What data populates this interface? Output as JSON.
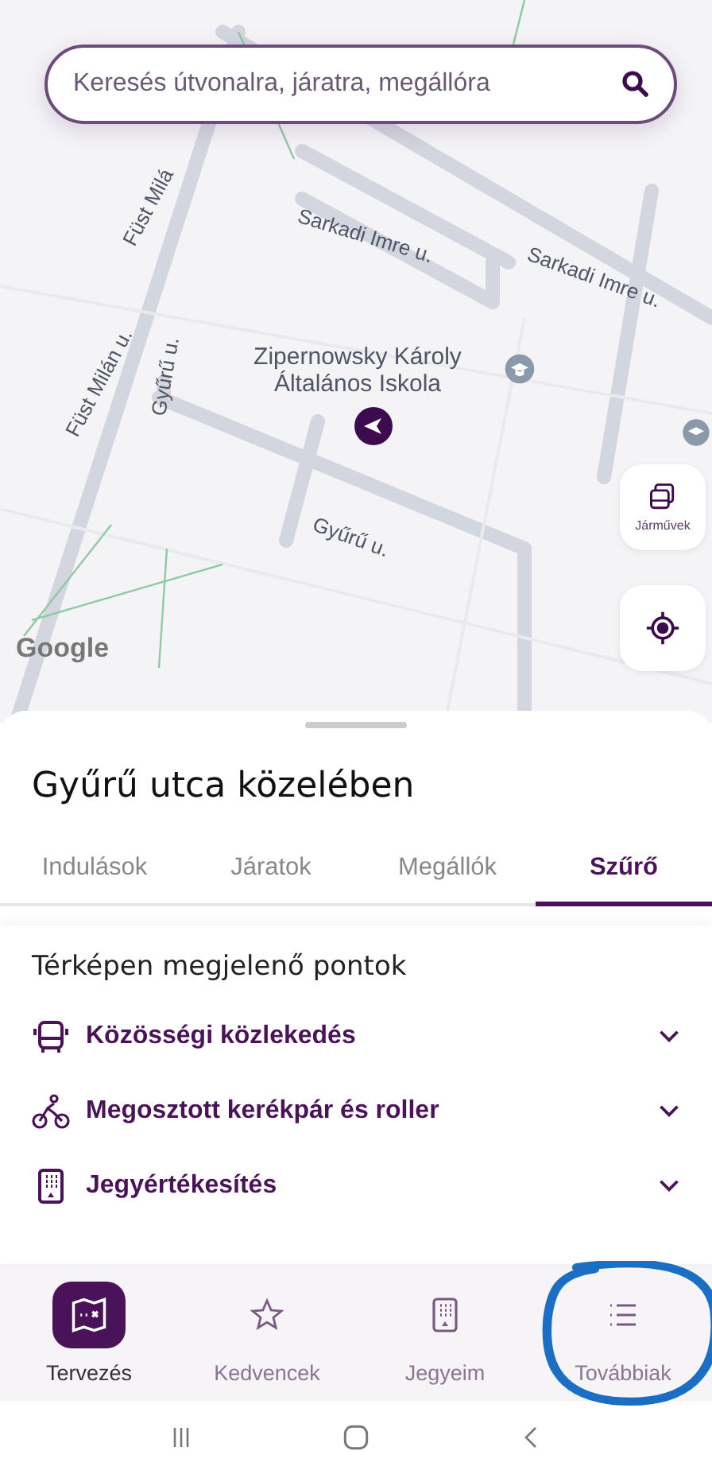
{
  "map": {
    "labels": [
      {
        "text": "Füst Milá",
        "kind": "street"
      },
      {
        "text": "Sarkadi Imre u.",
        "kind": "street"
      },
      {
        "text": "Sarkadi Imre u.",
        "kind": "street"
      },
      {
        "text": "Füst Milán u.",
        "kind": "street"
      },
      {
        "text": "Gyűrű u.",
        "kind": "street"
      },
      {
        "text": "Gyűrű u.",
        "kind": "street"
      },
      {
        "text": "Zipernowsky Károly Általános Iskola",
        "kind": "poi"
      },
      {
        "text": "Google",
        "kind": "logo"
      }
    ],
    "vehicles_button": {
      "label": "Járművek"
    }
  },
  "search": {
    "placeholder": "Keresés útvonalra, járatra, megállóra"
  },
  "sheet": {
    "title": "Gyűrű utca közelében",
    "tabs": [
      {
        "label": "Indulások",
        "selected": false
      },
      {
        "label": "Járatok",
        "selected": false
      },
      {
        "label": "Megállók",
        "selected": false
      },
      {
        "label": "Szűrő",
        "selected": true
      }
    ],
    "section_title": "Térképen megjelenő pontok",
    "filters": [
      {
        "kind": "bus",
        "label": "Közösségi közlekedés",
        "expanded": false
      },
      {
        "kind": "bike",
        "label": "Megosztott kerékpár és roller",
        "expanded": false
      },
      {
        "kind": "ticket",
        "label": "Jegyértékesítés",
        "expanded": false
      }
    ]
  },
  "bottom_nav": [
    {
      "kind": "map",
      "label": "Tervezés",
      "selected": true,
      "circled": false
    },
    {
      "kind": "star",
      "label": "Kedvencek",
      "selected": false,
      "circled": false
    },
    {
      "kind": "ticket",
      "label": "Jegyeim",
      "selected": false,
      "circled": false
    },
    {
      "kind": "list",
      "label": "Továbbiak",
      "selected": false,
      "circled": true
    }
  ]
}
